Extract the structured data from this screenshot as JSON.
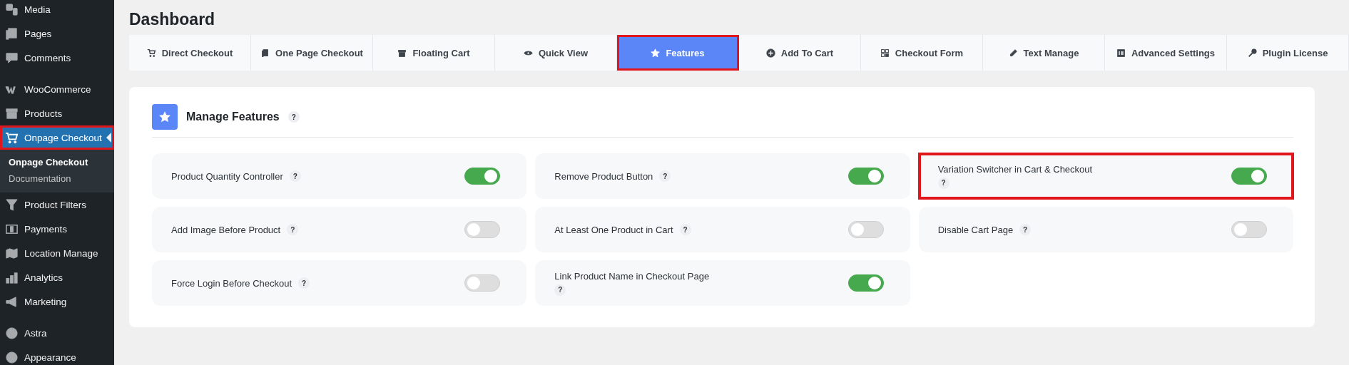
{
  "sidebar": {
    "groups": [
      [
        {
          "label": "Media",
          "selected": false,
          "highlighted": false
        },
        {
          "label": "Pages",
          "selected": false,
          "highlighted": false
        },
        {
          "label": "Comments",
          "selected": false,
          "highlighted": false
        }
      ],
      [
        {
          "label": "WooCommerce",
          "selected": false,
          "highlighted": false
        },
        {
          "label": "Products",
          "selected": false,
          "highlighted": false
        },
        {
          "label": "Onpage Checkout",
          "selected": true,
          "highlighted": true,
          "children": [
            {
              "label": "Onpage Checkout",
              "selected": true
            },
            {
              "label": "Documentation",
              "selected": false
            }
          ]
        },
        {
          "label": "Product Filters",
          "selected": false,
          "highlighted": false
        },
        {
          "label": "Payments",
          "selected": false,
          "highlighted": false
        },
        {
          "label": "Location Manage",
          "selected": false,
          "highlighted": false
        },
        {
          "label": "Analytics",
          "selected": false,
          "highlighted": false
        },
        {
          "label": "Marketing",
          "selected": false,
          "highlighted": false
        }
      ],
      [
        {
          "label": "Astra",
          "selected": false,
          "highlighted": false
        },
        {
          "label": "Appearance",
          "selected": false,
          "highlighted": false
        }
      ]
    ]
  },
  "page": {
    "title": "Dashboard"
  },
  "tabs": [
    {
      "label": "Direct Checkout",
      "selected": false,
      "highlighted": false
    },
    {
      "label": "One Page Checkout",
      "selected": false,
      "highlighted": false
    },
    {
      "label": "Floating Cart",
      "selected": false,
      "highlighted": false
    },
    {
      "label": "Quick View",
      "selected": false,
      "highlighted": false
    },
    {
      "label": "Features",
      "selected": true,
      "highlighted": true
    },
    {
      "label": "Add To Cart",
      "selected": false,
      "highlighted": false
    },
    {
      "label": "Checkout Form",
      "selected": false,
      "highlighted": false
    },
    {
      "label": "Text Manage",
      "selected": false,
      "highlighted": false
    },
    {
      "label": "Advanced Settings",
      "selected": false,
      "highlighted": false
    },
    {
      "label": "Plugin License",
      "selected": false,
      "highlighted": false
    }
  ],
  "panel": {
    "title": "Manage Features",
    "help": "?",
    "features": [
      {
        "label": "Product Quantity Controller",
        "help": "?",
        "on": true,
        "highlighted": false
      },
      {
        "label": "Remove Product Button",
        "help": "?",
        "on": true,
        "highlighted": false
      },
      {
        "label": "Variation Switcher in Cart & Checkout",
        "help": "?",
        "on": true,
        "highlighted": true
      },
      {
        "label": "Add Image Before Product",
        "help": "?",
        "on": false,
        "highlighted": false
      },
      {
        "label": "At Least One Product in Cart",
        "help": "?",
        "on": false,
        "highlighted": false
      },
      {
        "label": "Disable Cart Page",
        "help": "?",
        "on": false,
        "highlighted": false
      },
      {
        "label": "Force Login Before Checkout",
        "help": "?",
        "on": false,
        "highlighted": false
      },
      {
        "label": "Link Product Name in Checkout Page",
        "help": "?",
        "on": true,
        "highlighted": false
      }
    ]
  }
}
